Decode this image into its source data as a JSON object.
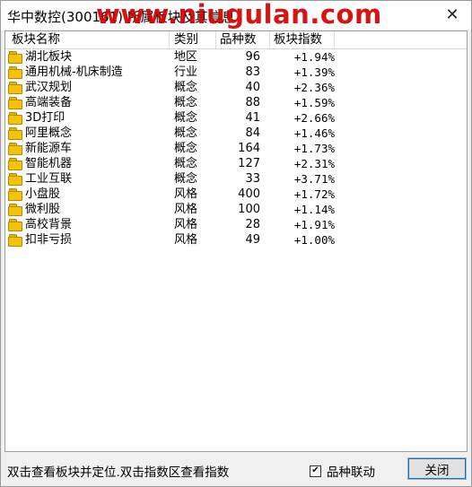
{
  "window": {
    "title": "华中数控(300161) 所属板块及其信息",
    "watermark": "www.niugulan.com"
  },
  "table": {
    "headers": [
      "板块名称",
      "类别",
      "品种数",
      "板块指数"
    ],
    "rows": [
      {
        "name": "湖北板块",
        "type": "地区",
        "count": "96",
        "index": "+1.94%"
      },
      {
        "name": "通用机械-机床制造",
        "type": "行业",
        "count": "83",
        "index": "+1.39%"
      },
      {
        "name": "武汉规划",
        "type": "概念",
        "count": "40",
        "index": "+2.36%"
      },
      {
        "name": "高端装备",
        "type": "概念",
        "count": "88",
        "index": "+1.59%"
      },
      {
        "name": "3D打印",
        "type": "概念",
        "count": "41",
        "index": "+2.66%"
      },
      {
        "name": "阿里概念",
        "type": "概念",
        "count": "84",
        "index": "+1.46%"
      },
      {
        "name": "新能源车",
        "type": "概念",
        "count": "164",
        "index": "+1.73%"
      },
      {
        "name": "智能机器",
        "type": "概念",
        "count": "127",
        "index": "+2.31%"
      },
      {
        "name": "工业互联",
        "type": "概念",
        "count": "33",
        "index": "+3.71%"
      },
      {
        "name": "小盘股",
        "type": "风格",
        "count": "400",
        "index": "+1.72%"
      },
      {
        "name": "微利股",
        "type": "风格",
        "count": "100",
        "index": "+1.14%"
      },
      {
        "name": "高校背景",
        "type": "风格",
        "count": "28",
        "index": "+1.91%"
      },
      {
        "name": "扣非亏损",
        "type": "风格",
        "count": "49",
        "index": "+1.00%"
      }
    ]
  },
  "footer": {
    "status_text": "双击查看板块并定位.双击指数区查看指数",
    "checkbox_label": "品种联动",
    "checkbox_checked": true,
    "close_button": "关闭"
  },
  "icons": {
    "row_icon": "folder-icon",
    "window_close": "close-icon"
  },
  "colors": {
    "watermark": "#d40000",
    "folder": "#f5c400",
    "button_focus": "#0078d7"
  }
}
